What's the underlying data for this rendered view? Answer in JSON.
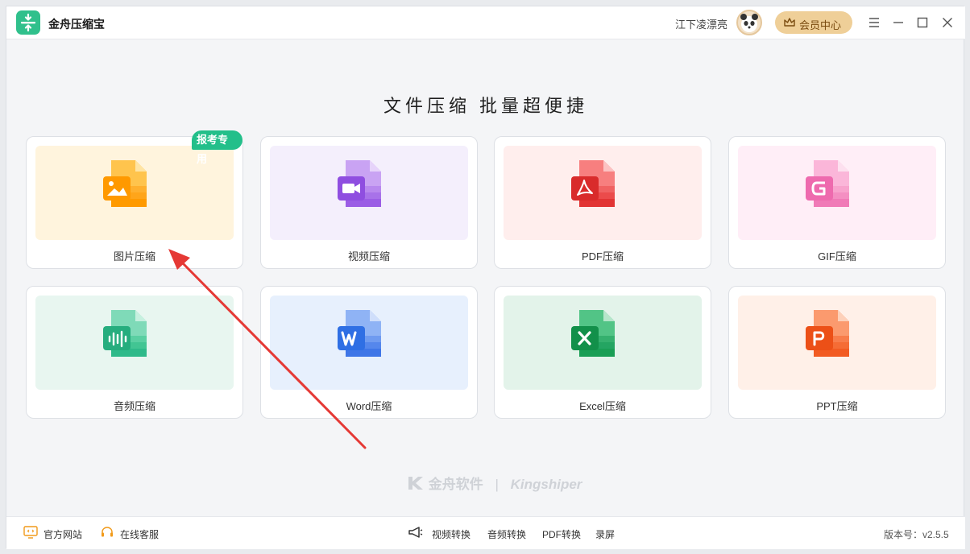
{
  "app": {
    "title": "金舟压缩宝"
  },
  "header": {
    "username": "江下凌漂亮",
    "vip_label": "会员中心",
    "controls": [
      "menu-icon",
      "minimize-icon",
      "maximize-icon",
      "close-icon"
    ]
  },
  "main": {
    "headline": "文件压缩  批量超便捷",
    "cards": [
      {
        "label": "图片压缩",
        "badge": "报考专用",
        "icon": "image-file-icon",
        "color": "#ffa21a"
      },
      {
        "label": "视频压缩",
        "icon": "video-file-icon",
        "color": "#9b5de5"
      },
      {
        "label": "PDF压缩",
        "icon": "pdf-file-icon",
        "color": "#e83a3a"
      },
      {
        "label": "GIF压缩",
        "icon": "gif-file-icon",
        "color": "#f07ab7"
      },
      {
        "label": "音频压缩",
        "icon": "audio-file-icon",
        "color": "#2fba8a"
      },
      {
        "label": "Word压缩",
        "icon": "word-file-icon",
        "color": "#2f6fe4"
      },
      {
        "label": "Excel压缩",
        "icon": "excel-file-icon",
        "color": "#1a9e55"
      },
      {
        "label": "PPT压缩",
        "icon": "ppt-file-icon",
        "color": "#f25b22"
      }
    ]
  },
  "watermark": {
    "cn": "金舟软件",
    "sep": "|",
    "en": "Kingshiper"
  },
  "footer": {
    "website": "官方网站",
    "support": "在线客服",
    "links": [
      "视频转换",
      "音频转换",
      "PDF转换",
      "录屏"
    ],
    "version": "版本号：v2.5.5"
  }
}
